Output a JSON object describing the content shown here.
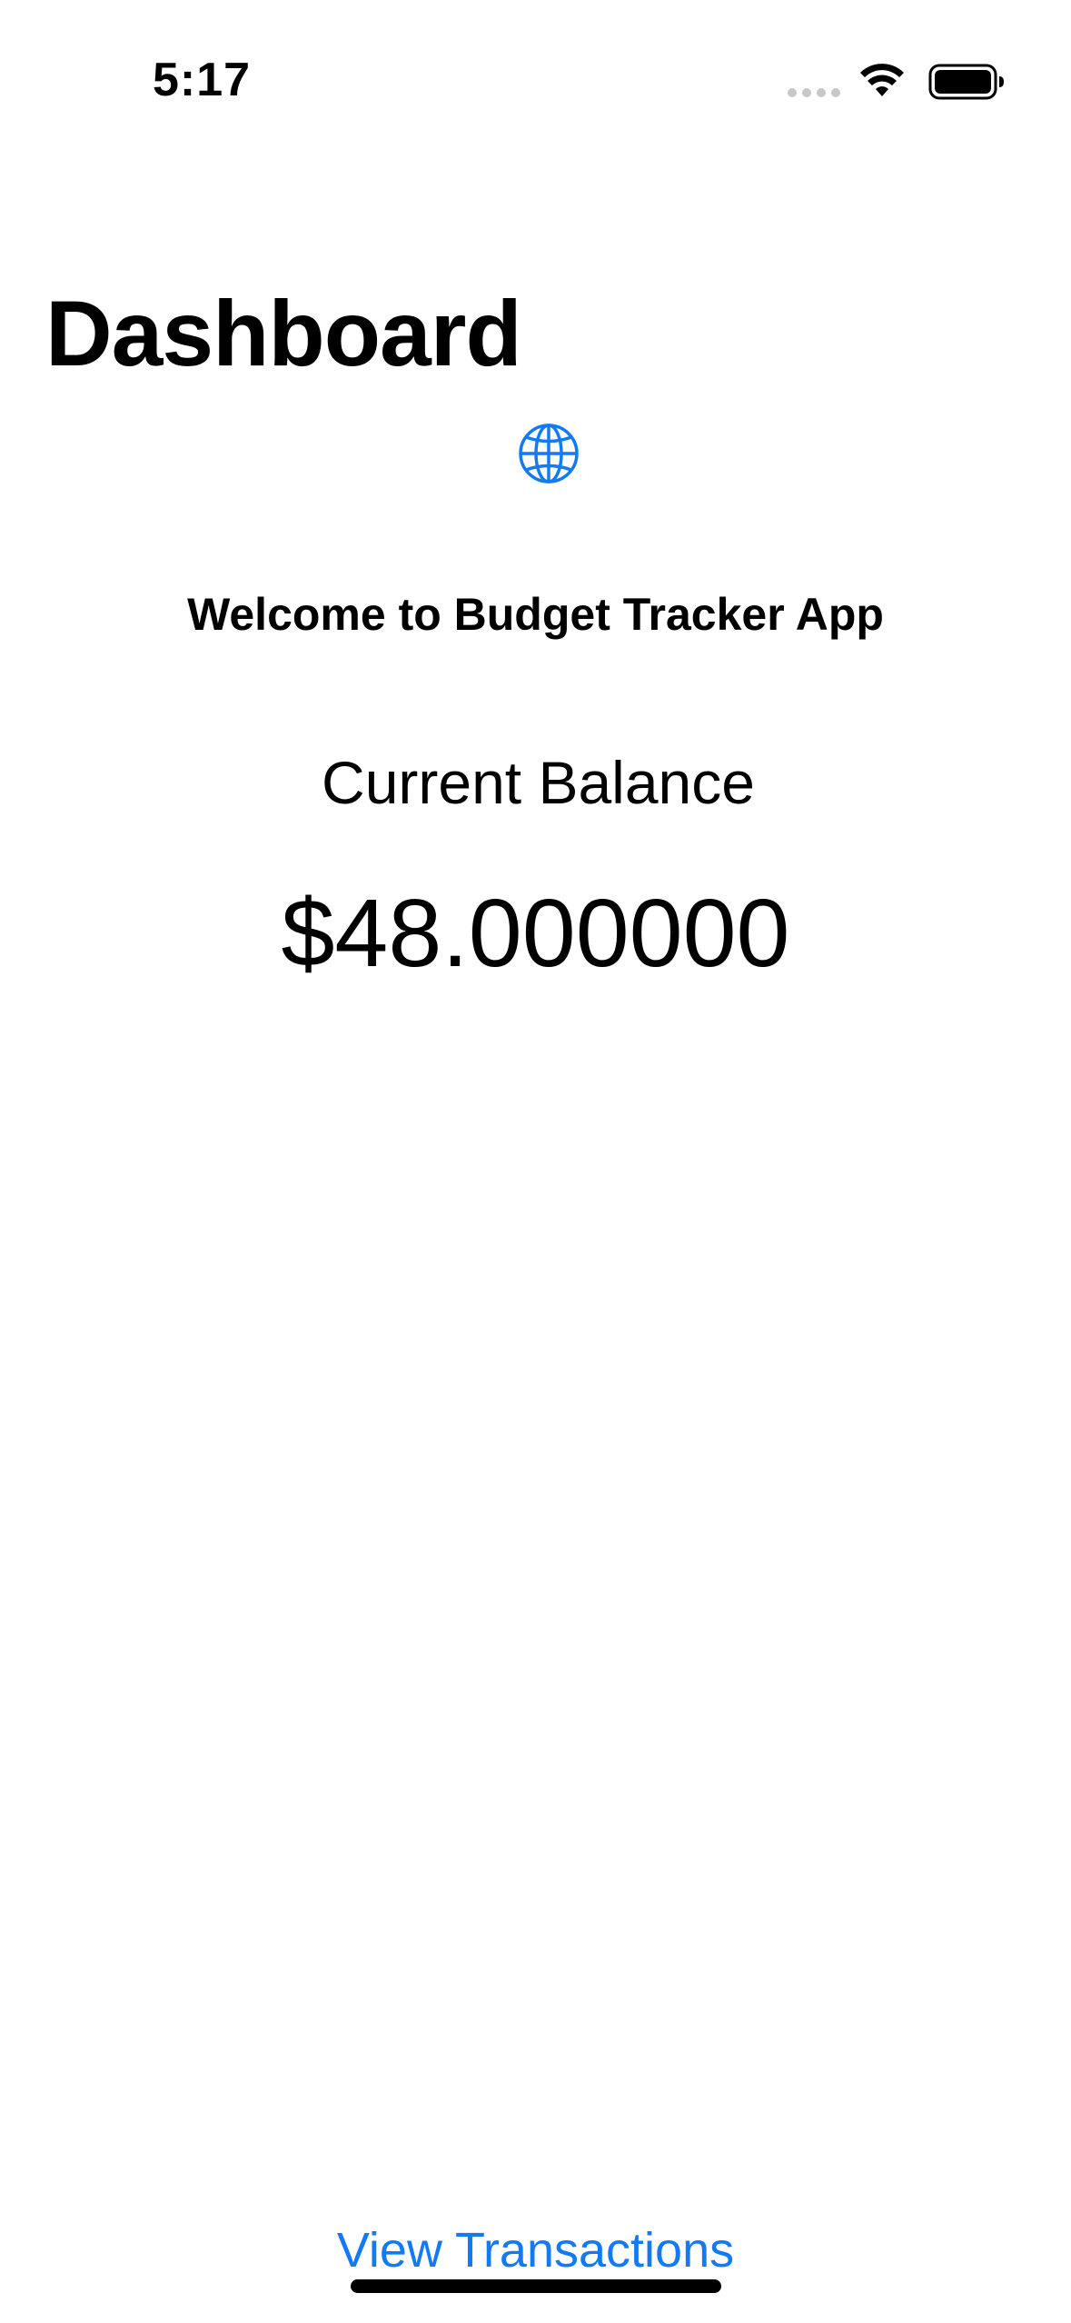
{
  "status_bar": {
    "time": "5:17",
    "icons": [
      "cellular-signal-icon",
      "wifi-icon",
      "battery-icon"
    ]
  },
  "header": {
    "title": "Dashboard"
  },
  "main": {
    "icon": "globe-icon",
    "welcome": "Welcome to Budget Tracker App",
    "balance_label": "Current Balance",
    "balance_value": "$48.000000"
  },
  "footer": {
    "view_transactions_label": "View Transactions"
  },
  "colors": {
    "accent": "#147AF3",
    "text": "#000000",
    "background": "#FFFFFF"
  }
}
